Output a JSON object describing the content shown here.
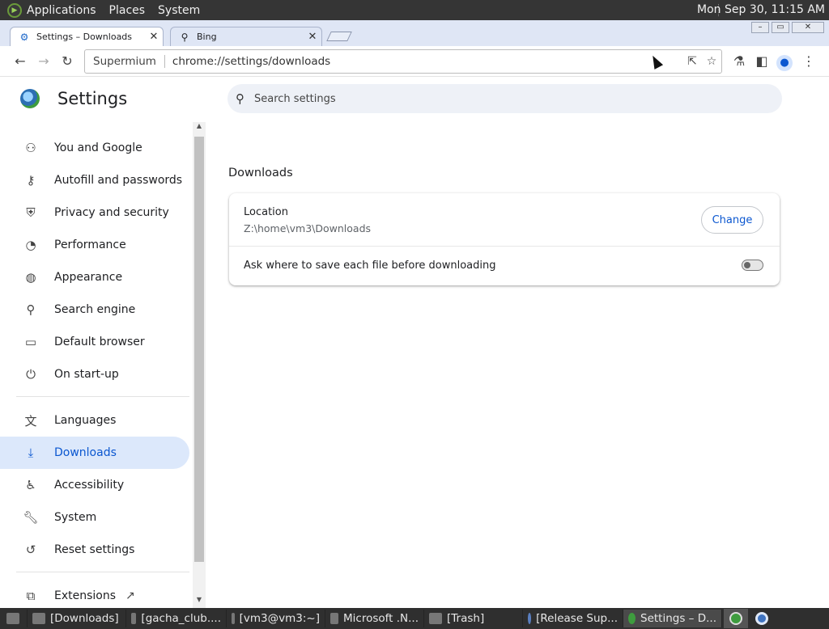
{
  "top_panel": {
    "menus": [
      "Applications",
      "Places",
      "System"
    ],
    "clock": "Mon Sep 30, 11:15 AM"
  },
  "browser": {
    "tabs": [
      {
        "label": "Settings – Downloads",
        "icon": "gear-icon",
        "active": true
      },
      {
        "label": "Bing",
        "icon": "search-icon",
        "active": false
      }
    ],
    "omnibox": {
      "site": "Supermium",
      "url": "chrome://settings/downloads"
    }
  },
  "settings": {
    "title": "Settings",
    "search_placeholder": "Search settings",
    "nav": [
      {
        "label": "You and Google",
        "icon": "person-icon"
      },
      {
        "label": "Autofill and passwords",
        "icon": "key-icon"
      },
      {
        "label": "Privacy and security",
        "icon": "shield-icon"
      },
      {
        "label": "Performance",
        "icon": "speedometer-icon"
      },
      {
        "label": "Appearance",
        "icon": "palette-icon"
      },
      {
        "label": "Search engine",
        "icon": "search-icon"
      },
      {
        "label": "Default browser",
        "icon": "window-icon"
      },
      {
        "label": "On start-up",
        "icon": "power-icon"
      },
      {
        "label": "Languages",
        "icon": "translate-icon"
      },
      {
        "label": "Downloads",
        "icon": "download-icon",
        "selected": true
      },
      {
        "label": "Accessibility",
        "icon": "accessibility-icon"
      },
      {
        "label": "System",
        "icon": "wrench-icon"
      },
      {
        "label": "Reset settings",
        "icon": "reset-icon"
      },
      {
        "label": "Extensions",
        "icon": "puzzle-icon"
      }
    ],
    "downloads": {
      "section_title": "Downloads",
      "location_label": "Location",
      "location_value": "Z:\\home\\vm3\\Downloads",
      "change_button": "Change",
      "ask_label": "Ask where to save each file before downloading",
      "ask_enabled": false
    }
  },
  "taskbar": {
    "tasks": [
      {
        "label": "[Downloads]",
        "icon": "folder-icon"
      },
      {
        "label": "[gacha_club....",
        "icon": "folder-icon"
      },
      {
        "label": "[vm3@vm3:~]",
        "icon": "terminal-icon"
      },
      {
        "label": "Microsoft .N...",
        "icon": "installer-icon"
      },
      {
        "label": "[Trash]",
        "icon": "trash-icon"
      },
      {
        "label": "[Release Sup...",
        "icon": "browser-icon"
      },
      {
        "label": "Settings – D...",
        "icon": "settings-icon",
        "active": true
      }
    ]
  }
}
